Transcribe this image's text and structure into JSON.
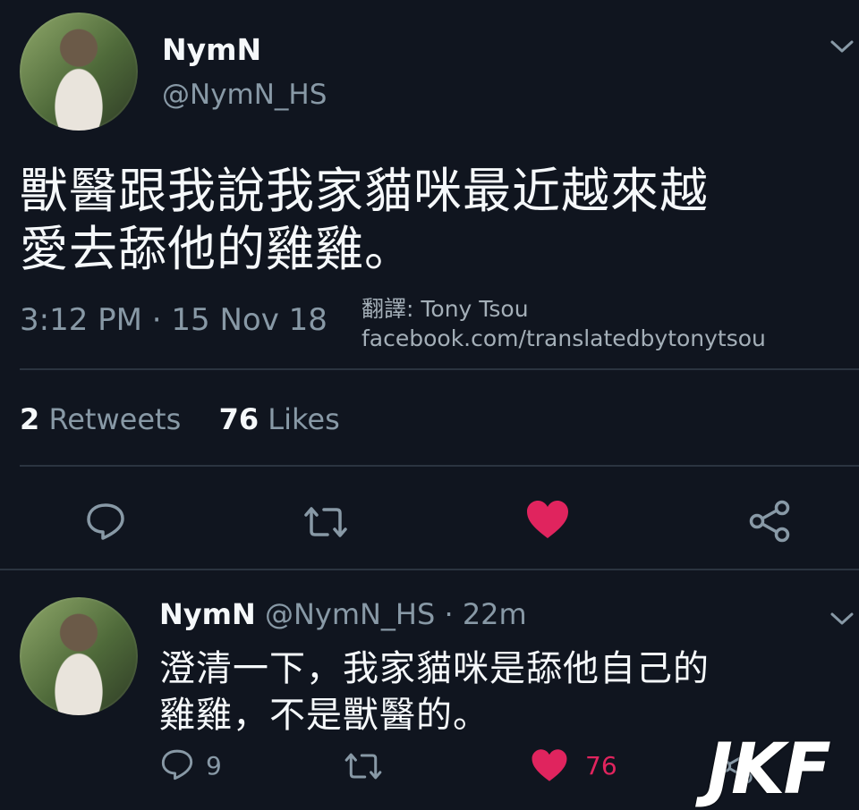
{
  "main_tweet": {
    "display_name": "NymN",
    "handle": "@NymN_HS",
    "text_line1": "獸醫跟我說我家貓咪最近越來越",
    "text_line2": "愛去舔他的雞雞。",
    "timestamp": "3:12 PM · 15 Nov 18",
    "translation_credit": "翻譯: Tony Tsou",
    "translation_url": "facebook.com/translatedbytonytsou",
    "retweets_count": "2",
    "retweets_label": "Retweets",
    "likes_count": "76",
    "likes_label": "Likes"
  },
  "reply_tweet": {
    "display_name": "NymN",
    "handle_time": "@NymN_HS · 22m",
    "text_line1": "澄清一下，我家貓咪是舔他自己的",
    "text_line2": "雞雞，不是獸醫的。",
    "reply_count": "9",
    "like_count": "76"
  },
  "watermark": "JKF",
  "colors": {
    "background": "#10151f",
    "muted": "#8899a6",
    "like": "#e0245e",
    "divider": "#2b3440"
  },
  "icons": [
    "chevron-down-icon",
    "reply-icon",
    "retweet-icon",
    "heart-icon",
    "share-icon"
  ]
}
